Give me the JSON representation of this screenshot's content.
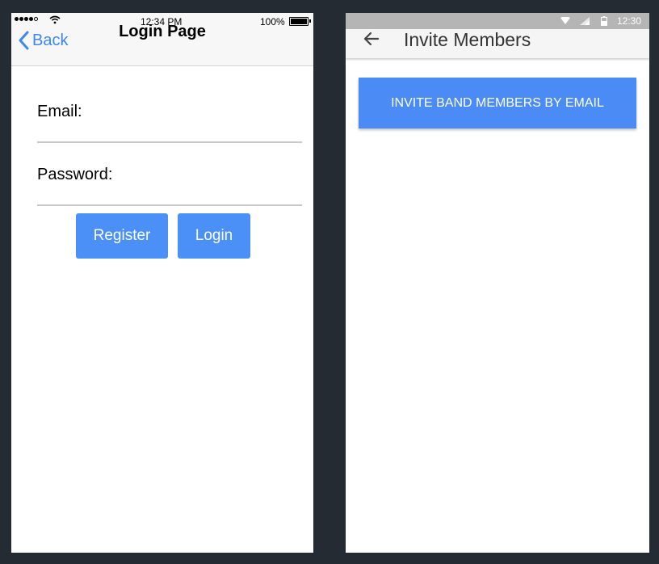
{
  "ios": {
    "status_bar": {
      "time": "12:34 PM",
      "battery_percent": "100%",
      "signal_dots_filled": 4,
      "signal_dots_total": 5
    },
    "nav": {
      "back_label": "Back",
      "title": "Login Page"
    },
    "form": {
      "email_label": "Email:",
      "email_value": "",
      "password_label": "Password:",
      "password_value": ""
    },
    "buttons": {
      "register_label": "Register",
      "login_label": "Login"
    },
    "colors": {
      "accent": "#3b88f0",
      "button": "#4a90f7"
    }
  },
  "android": {
    "status_bar": {
      "time": "12:30"
    },
    "app_bar": {
      "title": "Invite Members"
    },
    "invite_button_label": "INVITE BAND MEMBERS BY EMAIL",
    "colors": {
      "button": "#4a8bf5",
      "status_bar": "#b5b5b5"
    }
  }
}
